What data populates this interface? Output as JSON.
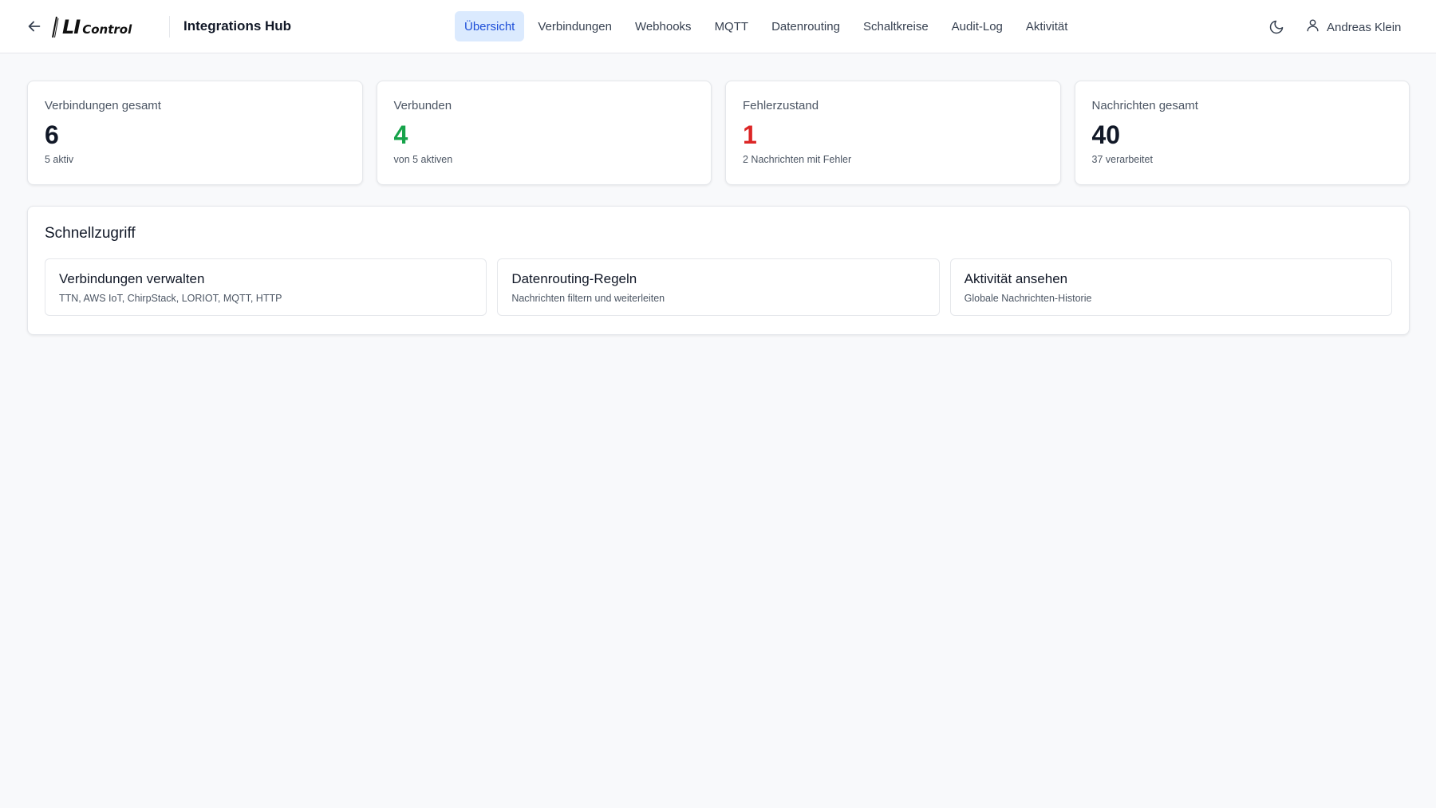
{
  "header": {
    "logo_text_main": "LI",
    "logo_text_sub": "Control",
    "app_title": "Integrations Hub",
    "back_icon": "arrow-left-icon",
    "theme_icon": "moon-icon",
    "user_icon": "user-icon",
    "user_name": "Andreas Klein"
  },
  "nav": {
    "tabs": [
      {
        "label": "Übersicht",
        "active": true
      },
      {
        "label": "Verbindungen"
      },
      {
        "label": "Webhooks"
      },
      {
        "label": "MQTT"
      },
      {
        "label": "Datenrouting"
      },
      {
        "label": "Schaltkreise"
      },
      {
        "label": "Audit-Log"
      },
      {
        "label": "Aktivität"
      }
    ]
  },
  "stats": [
    {
      "label": "Verbindungen gesamt",
      "value": "6",
      "sub": "5 aktiv",
      "color": "#111827"
    },
    {
      "label": "Verbunden",
      "value": "4",
      "sub": "von 5 aktiven",
      "color": "#16a34a"
    },
    {
      "label": "Fehlerzustand",
      "value": "1",
      "sub": "2 Nachrichten mit Fehler",
      "color": "#dc2626"
    },
    {
      "label": "Nachrichten gesamt",
      "value": "40",
      "sub": "37 verarbeitet",
      "color": "#111827"
    }
  ],
  "quick_access": {
    "title": "Schnellzugriff",
    "items": [
      {
        "title": "Verbindungen verwalten",
        "desc": "TTN, AWS IoT, ChirpStack, LORIOT, MQTT, HTTP"
      },
      {
        "title": "Datenrouting-Regeln",
        "desc": "Nachrichten filtern und weiterleiten"
      },
      {
        "title": "Aktivität ansehen",
        "desc": "Globale Nachrichten-Historie"
      }
    ]
  },
  "colors": {
    "accent": "#1d4ed8",
    "accent_bg": "#dbeafe",
    "success": "#16a34a",
    "error": "#dc2626"
  }
}
